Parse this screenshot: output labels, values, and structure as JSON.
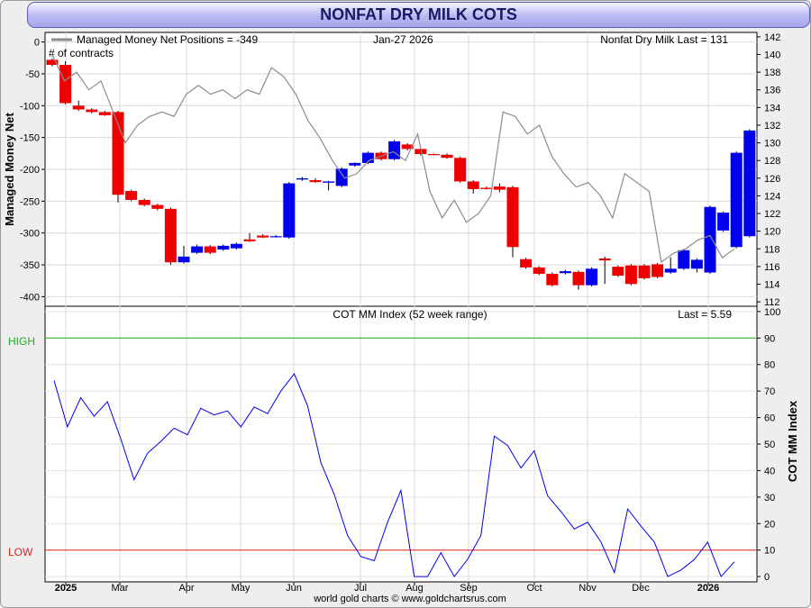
{
  "header": {
    "title": "NONFAT DRY MILK COTS"
  },
  "footer": {
    "credit": "world gold charts © www.goldchartsrus.com"
  },
  "chart_data": [
    {
      "type": "candlestick",
      "panel": "top",
      "legend_text": "Managed Money Net Positions = -349",
      "legend_sub": "# of contracts",
      "date_text": "Jan-27  2026",
      "last_text": "Nonfat Dry Milk Last = 131",
      "ylabel": "Managed Money Net",
      "ylim": [
        -415,
        15
      ],
      "y2lim": [
        111.5,
        142.5
      ],
      "y_ticks": [
        "0",
        "-50",
        "-100",
        "-150",
        "-200",
        "-250",
        "-300",
        "-350",
        "-400"
      ],
      "y2_ticks": [
        "142",
        "140",
        "138",
        "136",
        "134",
        "132",
        "130",
        "128",
        "126",
        "124",
        "122",
        "120",
        "118",
        "116",
        "114",
        "112"
      ],
      "x_ticks": [
        "2025",
        "Mar",
        "Apr",
        "May",
        "Jun",
        "Jul",
        "Aug",
        "Sep",
        "Oct",
        "Nov",
        "Dec",
        "2026"
      ],
      "up_color": "#0000ee",
      "down_color": "#ee0000",
      "price_color": "#8c8c8c",
      "series": [
        {
          "name": "Managed Money Net Positions",
          "candles": [
            {
              "o": -28,
              "c": -36,
              "h": -26,
              "l": -38
            },
            {
              "o": -36,
              "c": -96,
              "h": -30,
              "l": -98
            },
            {
              "o": -100,
              "c": -106,
              "h": -92,
              "l": -108
            },
            {
              "o": -106,
              "c": -110,
              "h": -104,
              "l": -112
            },
            {
              "o": -110,
              "c": -115,
              "h": -108,
              "l": -116
            },
            {
              "o": -110,
              "c": -240,
              "h": -108,
              "l": -252
            },
            {
              "o": -234,
              "c": -248,
              "h": -232,
              "l": -250
            },
            {
              "o": -248,
              "c": -256,
              "h": -246,
              "l": -258
            },
            {
              "o": -256,
              "c": -262,
              "h": -254,
              "l": -264
            },
            {
              "o": -262,
              "c": -346,
              "h": -260,
              "l": -350
            },
            {
              "o": -346,
              "c": -337,
              "h": -320,
              "l": -348
            },
            {
              "o": -331,
              "c": -321,
              "h": -318,
              "l": -333
            },
            {
              "o": -321,
              "c": -331,
              "h": -319,
              "l": -333
            },
            {
              "o": -326,
              "c": -320,
              "h": -318,
              "l": -328
            },
            {
              "o": -324,
              "c": -317,
              "h": -315,
              "l": -326
            },
            {
              "o": -310,
              "c": -313,
              "h": -300,
              "l": -314
            },
            {
              "o": -304,
              "c": -307,
              "h": -302,
              "l": -308
            },
            {
              "o": -306,
              "c": -305,
              "h": -303,
              "l": -307
            },
            {
              "o": -307,
              "c": -222,
              "h": -220,
              "l": -309
            },
            {
              "o": -216,
              "c": -214,
              "h": -212,
              "l": -218
            },
            {
              "o": -217,
              "c": -220,
              "h": -214,
              "l": -221
            },
            {
              "o": -221,
              "c": -219,
              "h": -218,
              "l": -233
            },
            {
              "o": -226,
              "c": -199,
              "h": -197,
              "l": -228
            },
            {
              "o": -194,
              "c": -190,
              "h": -189,
              "l": -196
            },
            {
              "o": -190,
              "c": -174,
              "h": -172,
              "l": -192
            },
            {
              "o": -174,
              "c": -184,
              "h": -172,
              "l": -186
            },
            {
              "o": -184,
              "c": -156,
              "h": -154,
              "l": -186
            },
            {
              "o": -161,
              "c": -168,
              "h": -159,
              "l": -170
            },
            {
              "o": -168,
              "c": -176,
              "h": -166,
              "l": -178
            },
            {
              "o": -176,
              "c": -177,
              "h": -175,
              "l": -178
            },
            {
              "o": -177,
              "c": -182,
              "h": -175,
              "l": -183
            },
            {
              "o": -182,
              "c": -219,
              "h": -180,
              "l": -221
            },
            {
              "o": -219,
              "c": -231,
              "h": -217,
              "l": -238
            },
            {
              "o": -229,
              "c": -231,
              "h": -227,
              "l": -232
            },
            {
              "o": -227,
              "c": -232,
              "h": -222,
              "l": -236
            },
            {
              "o": -228,
              "c": -322,
              "h": -226,
              "l": -338
            },
            {
              "o": -341,
              "c": -354,
              "h": -339,
              "l": -356
            },
            {
              "o": -354,
              "c": -364,
              "h": -352,
              "l": -366
            },
            {
              "o": -364,
              "c": -382,
              "h": -362,
              "l": -384
            },
            {
              "o": -363,
              "c": -360,
              "h": -358,
              "l": -365
            },
            {
              "o": -361,
              "c": -382,
              "h": -359,
              "l": -389
            },
            {
              "o": -382,
              "c": -356,
              "h": -354,
              "l": -384
            },
            {
              "o": -340,
              "c": -343,
              "h": -337,
              "l": -380
            },
            {
              "o": -353,
              "c": -367,
              "h": -351,
              "l": -369
            },
            {
              "o": -351,
              "c": -380,
              "h": -349,
              "l": -382
            },
            {
              "o": -351,
              "c": -371,
              "h": -349,
              "l": -373
            },
            {
              "o": -349,
              "c": -369,
              "h": -347,
              "l": -371
            },
            {
              "o": -362,
              "c": -356,
              "h": -338,
              "l": -364
            },
            {
              "o": -356,
              "c": -327,
              "h": -325,
              "l": -358
            },
            {
              "o": -356,
              "c": -342,
              "h": -340,
              "l": -362
            },
            {
              "o": -362,
              "c": -259,
              "h": -257,
              "l": -364
            },
            {
              "o": -296,
              "c": -268,
              "h": -266,
              "l": -298
            },
            {
              "o": -322,
              "c": -174,
              "h": -172,
              "l": -324
            },
            {
              "o": -305,
              "c": -139,
              "h": -137,
              "l": -307
            }
          ]
        },
        {
          "name": "Nonfat Dry Milk",
          "axis": "right",
          "values": [
            140.0,
            137.0,
            138.0,
            136.0,
            137.0,
            133.5,
            130.0,
            132.0,
            133.0,
            133.5,
            133.0,
            135.5,
            136.5,
            135.5,
            136.0,
            135.0,
            136.0,
            135.5,
            138.5,
            137.5,
            135.5,
            132.5,
            130.5,
            128.0,
            126.0,
            126.5,
            128.0,
            128.5,
            129.0,
            128.0,
            131.0,
            124.5,
            121.5,
            123.5,
            121.0,
            122.0,
            124.0,
            133.5,
            133.0,
            131.0,
            132.0,
            128.5,
            126.5,
            125.0,
            125.5,
            124.0,
            121.5,
            126.5,
            125.5,
            124.5,
            116.5,
            117.5,
            118.0,
            119.0,
            119.5,
            117.0,
            118.0
          ]
        }
      ]
    },
    {
      "type": "line",
      "panel": "bottom",
      "title": "COT MM Index (52 week range)",
      "last_text": "Last = 5.59",
      "ylabel": "COT MM Index",
      "ylim": [
        -2,
        102
      ],
      "y_ticks": [
        "100",
        "90",
        "80",
        "70",
        "60",
        "50",
        "40",
        "30",
        "20",
        "10",
        "0"
      ],
      "high_label": "HIGH",
      "low_label": "LOW",
      "high_level": 90,
      "low_level": 10,
      "high_color": "#22aa22",
      "low_color": "#dd2222",
      "line_color": "#0000ee",
      "series": [
        {
          "name": "COT MM Index",
          "values": [
            74,
            56.5,
            67.5,
            60.5,
            66,
            52,
            36.5,
            46.5,
            51,
            56,
            53.5,
            63.5,
            61,
            62.5,
            56.5,
            64,
            61.5,
            70,
            76.5,
            64.5,
            43,
            31,
            15.5,
            7.5,
            6,
            20.5,
            32.5,
            0,
            0,
            9,
            0,
            6.5,
            15.5,
            53,
            49.5,
            41,
            47.5,
            30.5,
            24.5,
            18,
            20.5,
            13,
            1.5,
            25.5,
            19,
            13,
            0,
            2.5,
            6.5,
            13,
            0,
            5.59
          ]
        }
      ]
    }
  ]
}
